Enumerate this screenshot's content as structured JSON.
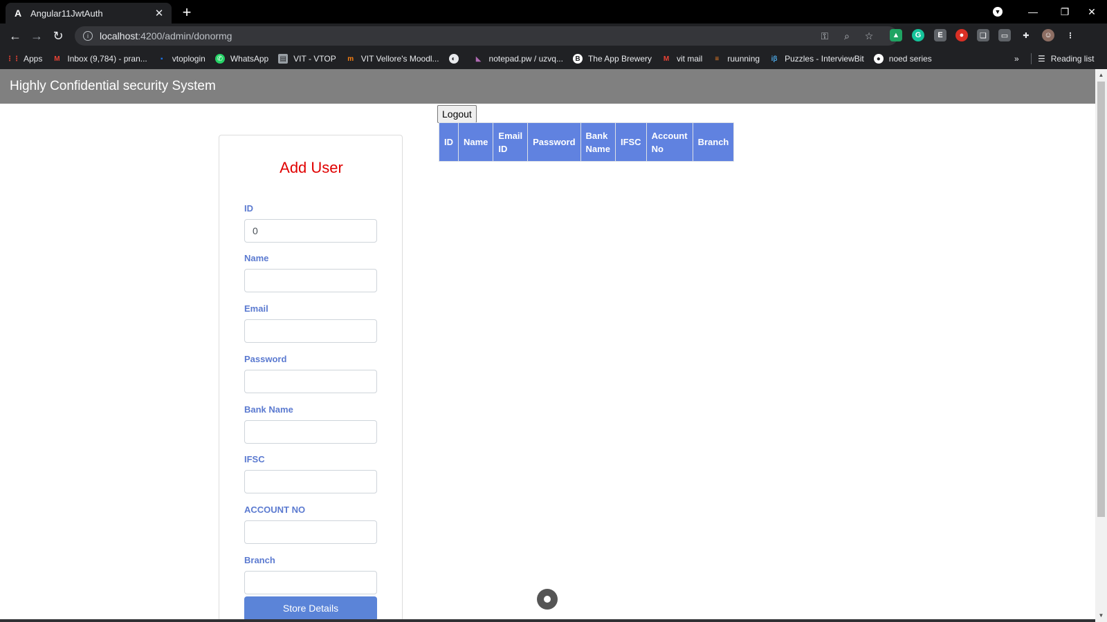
{
  "browser": {
    "tab_title": "Angular11JwtAuth",
    "tab_favicon": "A",
    "new_tab_label": "+",
    "url_host": "localhost",
    "url_rest": ":4200/admin/donormg",
    "bookmarks": [
      {
        "label": "Apps",
        "icon": "apps-grid-icon",
        "color": "#ea4335"
      },
      {
        "label": "Inbox (9,784) - pran...",
        "icon": "gmail-icon",
        "color": "#ea4335"
      },
      {
        "label": "vtoplogin",
        "icon": "vtop-icon",
        "color": "#1a73e8"
      },
      {
        "label": "WhatsApp",
        "icon": "whatsapp-icon",
        "color": "#25d366"
      },
      {
        "label": "VIT - VTOP",
        "icon": "vit-vtop-icon",
        "color": "#9aa0a6"
      },
      {
        "label": "VIT Vellore's Moodl...",
        "icon": "moodle-icon",
        "color": "#f98012"
      },
      {
        "label": "",
        "icon": "globe-icon",
        "color": "#e8eaed"
      },
      {
        "label": "notepad.pw / uzvq...",
        "icon": "notepad-icon",
        "color": "#b06ab3"
      },
      {
        "label": "The App Brewery",
        "icon": "app-brewery-icon",
        "color": "#ffffff"
      },
      {
        "label": "vit mail",
        "icon": "gmail-icon",
        "color": "#ea4335"
      },
      {
        "label": "ruunning",
        "icon": "stack-icon",
        "color": "#f48024"
      },
      {
        "label": "Puzzles - InterviewBit",
        "icon": "interviewbit-icon",
        "color": "#4aa3df"
      },
      {
        "label": "noed series",
        "icon": "github-icon",
        "color": "#ffffff"
      }
    ],
    "more_bookmarks": "»",
    "reading_list": "Reading list"
  },
  "app": {
    "header_title": "Highly Confidential security System",
    "logout_label": "Logout",
    "table_headers": [
      {
        "line1": "ID",
        "line2": ""
      },
      {
        "line1": "Name",
        "line2": ""
      },
      {
        "line1": "Email",
        "line2": "ID"
      },
      {
        "line1": "Password",
        "line2": ""
      },
      {
        "line1": "Bank",
        "line2": "Name"
      },
      {
        "line1": "IFSC",
        "line2": ""
      },
      {
        "line1": "Account",
        "line2": "No"
      },
      {
        "line1": "Branch",
        "line2": ""
      }
    ],
    "form": {
      "title": "Add User",
      "fields": [
        {
          "label": "ID",
          "value": "0"
        },
        {
          "label": "Name",
          "value": ""
        },
        {
          "label": "Email",
          "value": ""
        },
        {
          "label": "Password",
          "value": ""
        },
        {
          "label": "Bank Name",
          "value": ""
        },
        {
          "label": "IFSC",
          "value": ""
        },
        {
          "label": "ACCOUNT NO",
          "value": ""
        },
        {
          "label": "Branch",
          "value": ""
        }
      ],
      "submit_label": "Store Details"
    }
  },
  "colors": {
    "header_bg": "#808080",
    "table_header_bg": "#6082e0",
    "form_title": "#e00000",
    "form_label": "#5b7ad0",
    "submit_bg": "#5b84d8"
  }
}
